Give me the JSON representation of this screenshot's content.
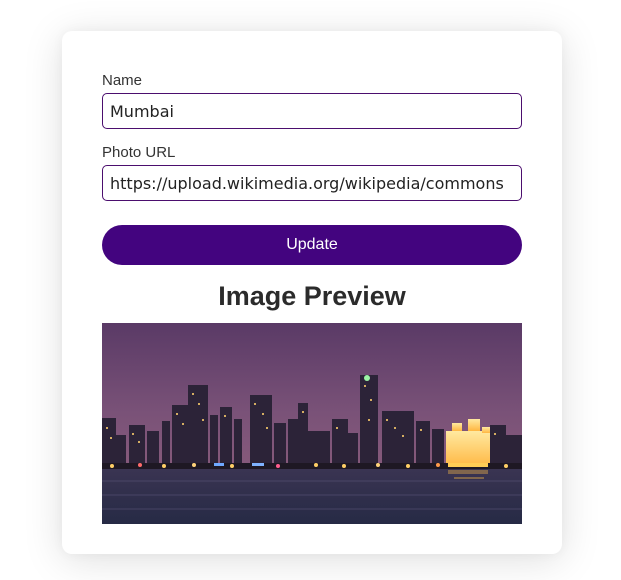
{
  "form": {
    "name_label": "Name",
    "name_value": "Mumbai",
    "url_label": "Photo URL",
    "url_value": "https://upload.wikimedia.org/wikipedia/commons",
    "update_label": "Update"
  },
  "preview": {
    "title": "Image Preview",
    "image_alt": "Mumbai skyline at dusk"
  },
  "colors": {
    "accent": "#43047f",
    "input_border": "#4b0e6e"
  }
}
